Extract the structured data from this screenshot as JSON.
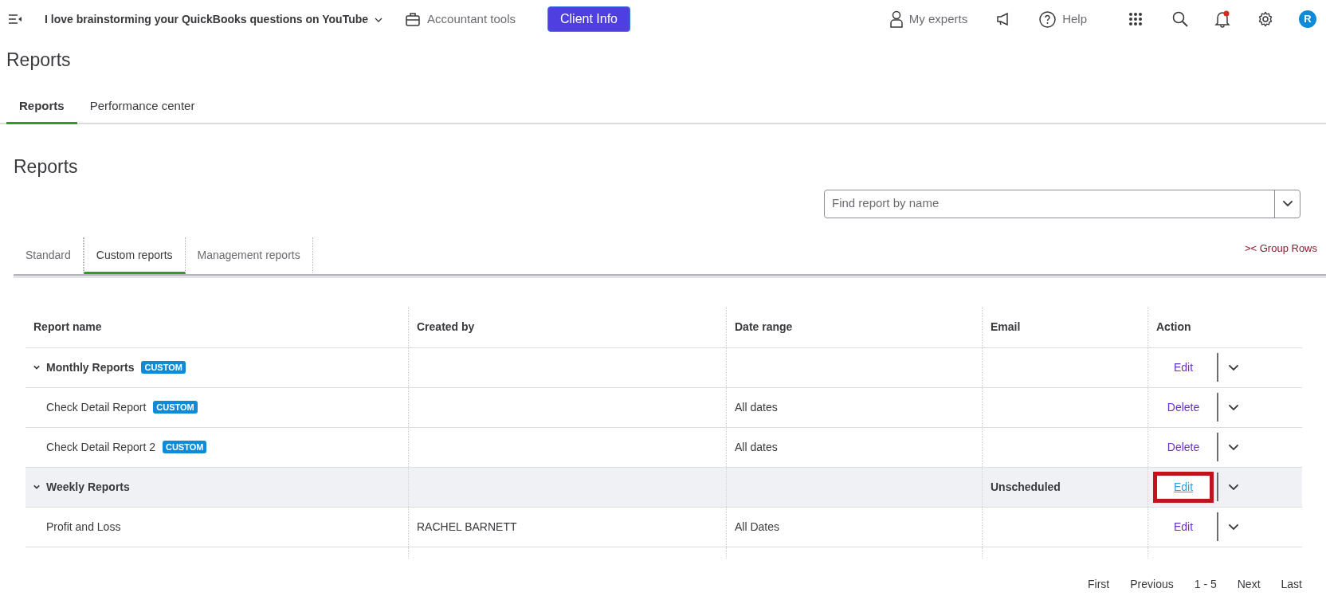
{
  "topbar": {
    "company": "I love brainstorming your QuickBooks questions on YouTube",
    "accountant_tools": "Accountant tools",
    "client_button": "Client Info",
    "my_experts": "My experts",
    "help": "Help",
    "notification_dot": true,
    "avatar": "R"
  },
  "page_title": "Reports",
  "page_tabs": [
    {
      "label": "Reports",
      "selected": true
    },
    {
      "label": "Performance center",
      "selected": false
    }
  ],
  "section_title": "Reports",
  "search": {
    "placeholder": "Find report by name"
  },
  "report_tabs": [
    {
      "label": "Standard",
      "selected": false
    },
    {
      "label": "Custom reports",
      "selected": true
    },
    {
      "label": "Management reports",
      "selected": false
    }
  ],
  "group_rows_link": ">< Group Rows",
  "table": {
    "columns": [
      "Report name",
      "Created by",
      "Date range",
      "Email",
      "Action"
    ],
    "rows": [
      {
        "kind": "group",
        "name": "Monthly Reports",
        "badge": "CUSTOM",
        "created_by": "",
        "date_range": "",
        "email": "",
        "action": "Edit",
        "highlighted": false,
        "annotated": false
      },
      {
        "kind": "item",
        "name": "Check Detail Report",
        "badge": "CUSTOM",
        "created_by": "",
        "date_range": "All dates",
        "email": "",
        "action": "Delete",
        "highlighted": false,
        "annotated": false
      },
      {
        "kind": "item",
        "name": "Check Detail Report 2",
        "badge": "CUSTOM",
        "created_by": "",
        "date_range": "All dates",
        "email": "",
        "action": "Delete",
        "highlighted": false,
        "annotated": false
      },
      {
        "kind": "group",
        "name": "Weekly Reports",
        "created_by": "",
        "date_range": "",
        "email": "Unscheduled",
        "action": "Edit",
        "highlighted": true,
        "annotated": true
      },
      {
        "kind": "item",
        "name": "Profit and Loss",
        "created_by": "RACHEL BARNETT",
        "date_range": "All Dates",
        "email": "",
        "action": "Edit",
        "highlighted": false,
        "annotated": false
      }
    ]
  },
  "pagination": [
    "First",
    "Previous",
    "1 - 5",
    "Next",
    "Last"
  ]
}
